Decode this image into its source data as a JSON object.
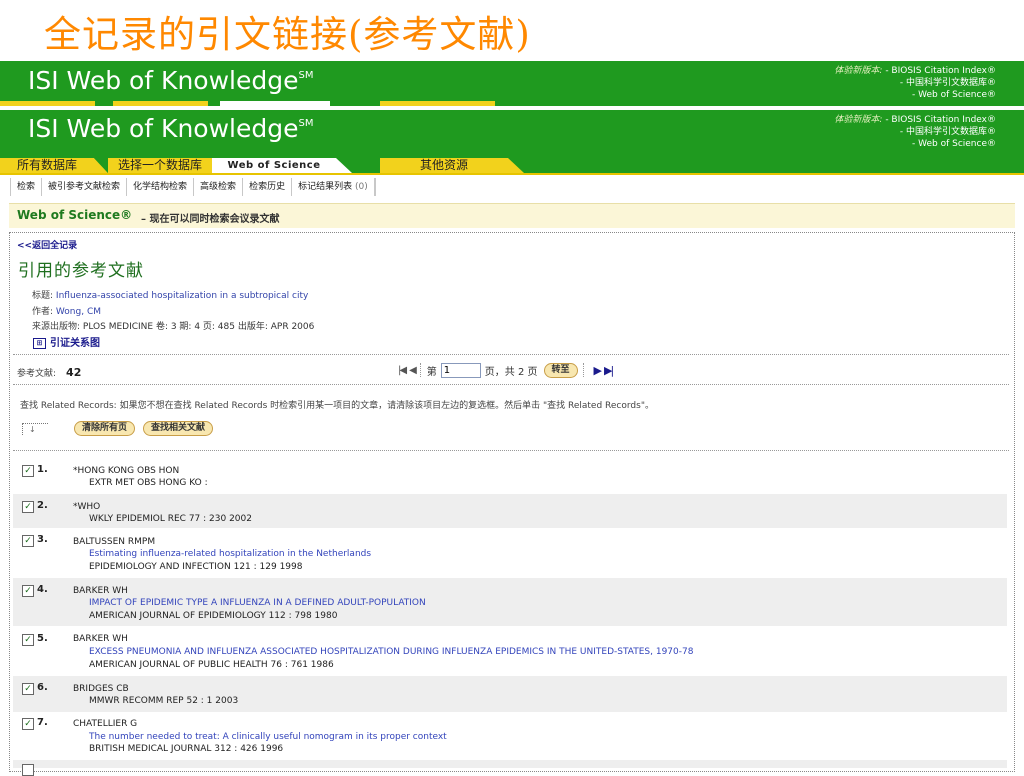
{
  "slide": {
    "title": "全记录的引文链接(参考文献)"
  },
  "banner": {
    "logo": "ISI Web of Knowledge",
    "logo_sm": "SM",
    "new_version_label": "体验新版本:",
    "new_version_items": [
      "- BIOSIS Citation Index®",
      "- 中国科学引文数据库®",
      "- Web of Science®"
    ]
  },
  "tabs": [
    {
      "label": "所有数据库"
    },
    {
      "label": "选择一个数据库"
    },
    {
      "label": "Web of Science"
    },
    {
      "label": "其他资源"
    }
  ],
  "subnav": {
    "items": [
      "检索",
      "被引参考文献检索",
      "化学结构检索",
      "高级检索",
      "检索历史",
      "标记结果列表"
    ],
    "marked_count": "(0)"
  },
  "wos": {
    "name": "Web of Science®",
    "note": "– 现在可以同时检索会议录文献"
  },
  "record": {
    "back_label": "<<返回全记录",
    "page_title": "引用的参考文献",
    "title_label": "标题:",
    "title_value": "Influenza-associated hospitalization in a subtropical city",
    "author_label": "作者:",
    "author_value": "Wong, CM",
    "source_label": "来源出版物:",
    "source_value": "PLOS MEDICINE 卷: 3 期: 4 页: 485 出版年: APR 2006",
    "citation_map": "引证关系图"
  },
  "results": {
    "count_label": "参考文献:",
    "count": "42",
    "page_prefix": "第",
    "page_value": "1",
    "page_suffix": "页，共 2 页",
    "go_label": "转至"
  },
  "instructions": "查找  Related Records: 如果您不想在查找  Related Records 时检索引用某一项目的文章，请清除该项目左边的复选框。然后单击 \"查找  Related Records\"。",
  "buttons": {
    "clear_page": "清除所有页",
    "find_related": "查找相关文献"
  },
  "references": [
    {
      "num": "1.",
      "author": "*HONG KONG OBS HON",
      "title": "",
      "source": "EXTR MET OBS HONG KO :",
      "checked": true
    },
    {
      "num": "2.",
      "author": "*WHO",
      "title": "",
      "source": "WKLY EPIDEMIOL REC 77 : 230 2002",
      "checked": true
    },
    {
      "num": "3.",
      "author": "BALTUSSEN RMPM",
      "title": "Estimating influenza-related hospitalization in the Netherlands",
      "source": "EPIDEMIOLOGY AND INFECTION 121 : 129 1998",
      "checked": true
    },
    {
      "num": "4.",
      "author": "BARKER WH",
      "title": "IMPACT OF EPIDEMIC TYPE A INFLUENZA IN A DEFINED ADULT-POPULATION",
      "source": "AMERICAN JOURNAL OF EPIDEMIOLOGY 112 : 798 1980",
      "checked": true
    },
    {
      "num": "5.",
      "author": "BARKER WH",
      "title": "EXCESS PNEUMONIA AND INFLUENZA ASSOCIATED HOSPITALIZATION DURING INFLUENZA EPIDEMICS IN THE UNITED-STATES, 1970-78",
      "source": "AMERICAN JOURNAL OF PUBLIC HEALTH 76 : 761 1986",
      "checked": true
    },
    {
      "num": "6.",
      "author": "BRIDGES CB",
      "title": "",
      "source": "MMWR RECOMM REP 52 : 1 2003",
      "checked": true
    },
    {
      "num": "7.",
      "author": "CHATELLIER G",
      "title": "The number needed to treat: A clinically useful nomogram in its proper context",
      "source": "BRITISH MEDICAL JOURNAL 312 : 426 1996",
      "checked": true
    }
  ],
  "colors": {
    "brand_green": "#1f9a1f",
    "tab_yellow": "#f2d21c",
    "title_orange": "#ff8800"
  }
}
